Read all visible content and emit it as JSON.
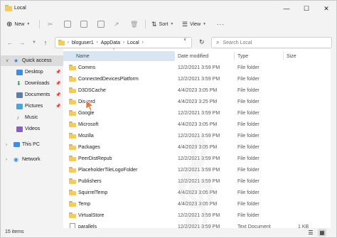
{
  "window": {
    "title": "Local"
  },
  "toolbar": {
    "new_label": "New",
    "sort_label": "Sort",
    "view_label": "View",
    "more_label": "···"
  },
  "address": {
    "crumbs": [
      "bloguser1",
      "AppData",
      "Local"
    ],
    "search_placeholder": "Search Local"
  },
  "navpane": {
    "items": [
      {
        "label": "Quick access",
        "icon": "star-icon",
        "pinned": false
      },
      {
        "label": "Desktop",
        "icon": "desktop-icon",
        "pinned": true
      },
      {
        "label": "Downloads",
        "icon": "downloads-icon",
        "pinned": true
      },
      {
        "label": "Documents",
        "icon": "documents-icon",
        "pinned": true
      },
      {
        "label": "Pictures",
        "icon": "pictures-icon",
        "pinned": true
      },
      {
        "label": "Music",
        "icon": "music-icon",
        "pinned": false
      },
      {
        "label": "Videos",
        "icon": "videos-icon",
        "pinned": false
      },
      {
        "label": "This PC",
        "icon": "pc-icon",
        "pinned": false
      },
      {
        "label": "Network",
        "icon": "network-icon",
        "pinned": false
      }
    ]
  },
  "columns": {
    "name": "Name",
    "date": "Date modified",
    "type": "Type",
    "size": "Size"
  },
  "files": [
    {
      "name": "Comms",
      "date": "12/2/2021 3:59 PM",
      "type": "File folder",
      "size": "",
      "kind": "folder"
    },
    {
      "name": "ConnectedDevicesPlatform",
      "date": "12/2/2021 3:59 PM",
      "type": "File folder",
      "size": "",
      "kind": "folder"
    },
    {
      "name": "D3DSCache",
      "date": "4/4/2023 3:05 PM",
      "type": "File folder",
      "size": "",
      "kind": "folder"
    },
    {
      "name": "Discord",
      "date": "4/4/2023 3:25 PM",
      "type": "File folder",
      "size": "",
      "kind": "folder"
    },
    {
      "name": "Google",
      "date": "12/2/2021 3:59 PM",
      "type": "File folder",
      "size": "",
      "kind": "folder"
    },
    {
      "name": "Microsoft",
      "date": "4/4/2023 3:05 PM",
      "type": "File folder",
      "size": "",
      "kind": "folder"
    },
    {
      "name": "Mozilla",
      "date": "12/2/2021 3:59 PM",
      "type": "File folder",
      "size": "",
      "kind": "folder"
    },
    {
      "name": "Packages",
      "date": "4/4/2023 3:05 PM",
      "type": "File folder",
      "size": "",
      "kind": "folder"
    },
    {
      "name": "PeerDistRepub",
      "date": "12/2/2021 3:59 PM",
      "type": "File folder",
      "size": "",
      "kind": "folder"
    },
    {
      "name": "PlaceholderTileLogoFolder",
      "date": "12/2/2021 3:59 PM",
      "type": "File folder",
      "size": "",
      "kind": "folder"
    },
    {
      "name": "Publishers",
      "date": "12/2/2021 3:59 PM",
      "type": "File folder",
      "size": "",
      "kind": "folder"
    },
    {
      "name": "SquirrelTemp",
      "date": "4/4/2023 3:05 PM",
      "type": "File folder",
      "size": "",
      "kind": "folder"
    },
    {
      "name": "Temp",
      "date": "4/4/2023 3:05 PM",
      "type": "File folder",
      "size": "",
      "kind": "folder"
    },
    {
      "name": "VirtualStore",
      "date": "12/2/2021 3:59 PM",
      "type": "File folder",
      "size": "",
      "kind": "folder"
    },
    {
      "name": "parallels",
      "date": "12/2/2021 3:59 PM",
      "type": "Text Document",
      "size": "1 KB",
      "kind": "file"
    }
  ],
  "status": {
    "count_text": "15 items"
  },
  "colors": {
    "selected_column_bg": "#d8e6f3",
    "folder": "#f4cc5a",
    "cursor": "#e8763a"
  }
}
